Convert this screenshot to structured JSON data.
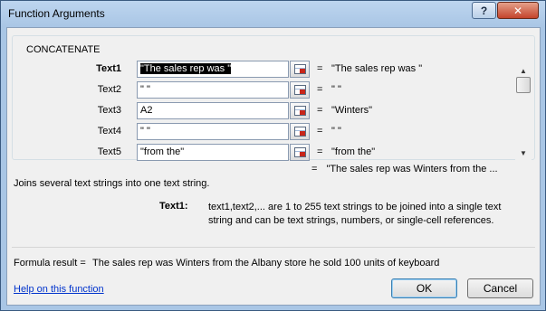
{
  "window": {
    "title": "Function Arguments",
    "help_button": "?",
    "close_button": "✕"
  },
  "function_name": "CONCATENATE",
  "arguments": [
    {
      "label": "Text1",
      "bold": true,
      "value": "\"The sales rep was \"",
      "result": "\"The sales rep was \""
    },
    {
      "label": "Text2",
      "bold": false,
      "value": "\" \"",
      "result": "\" \""
    },
    {
      "label": "Text3",
      "bold": false,
      "value": "A2",
      "result": "\"Winters\""
    },
    {
      "label": "Text4",
      "bold": false,
      "value": "\" \"",
      "result": "\" \""
    },
    {
      "label": "Text5",
      "bold": false,
      "value": "\"from the\"",
      "result": "\"from the\""
    }
  ],
  "equals_sign": "=",
  "function_result_preview": "\"The sales rep was  Winters from the ...",
  "function_description": "Joins several text strings into one text string.",
  "argument_help": {
    "label": "Text1:",
    "text": "text1,text2,... are 1 to 255 text strings to be joined into a single text string and can be text strings, numbers, or single-cell references."
  },
  "formula_result": {
    "label": "Formula result =",
    "value": "The sales rep was  Winters from the Albany store he sold 100 units of keyboard"
  },
  "help_link": "Help on this function",
  "buttons": {
    "ok": "OK",
    "cancel": "Cancel"
  },
  "icons": {
    "help": "help-icon",
    "close": "close-icon",
    "ref": "collapse-dialog-icon",
    "scroll_up": "scroll-up-arrow-icon",
    "scroll_down": "scroll-down-arrow-icon"
  },
  "colors": {
    "titlebar": "#a9c6e5",
    "link": "#0033cc",
    "close_button": "#c4442c"
  }
}
